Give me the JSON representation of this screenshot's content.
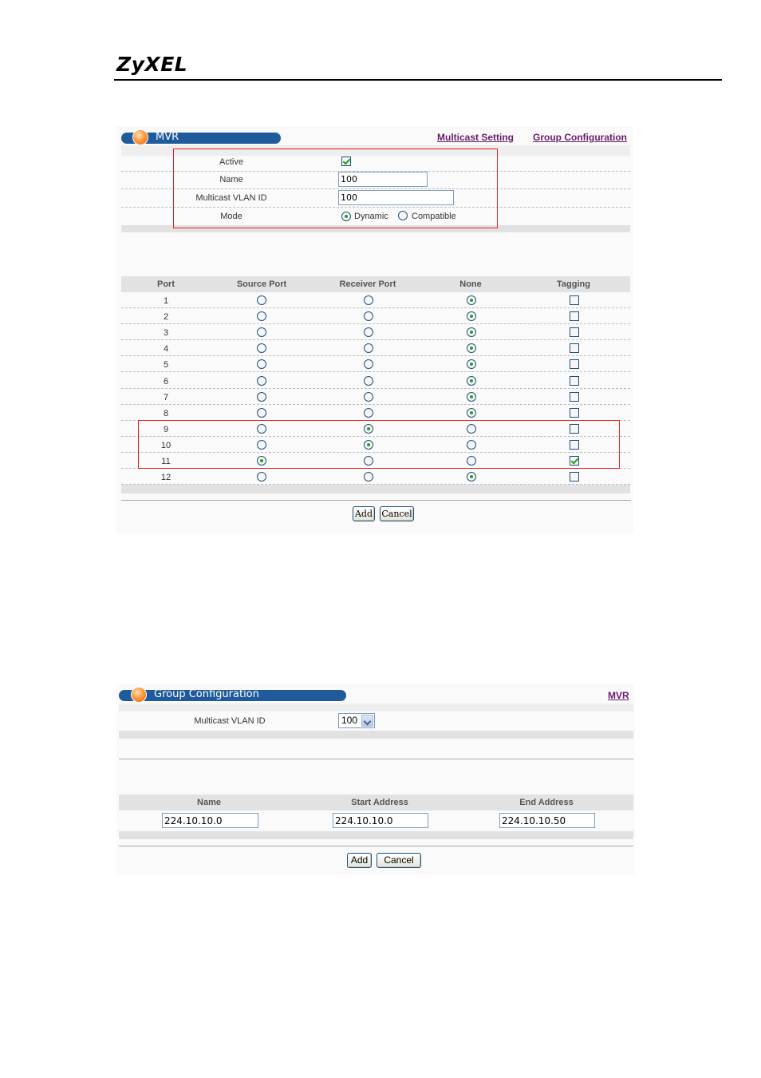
{
  "brand": {
    "logo": "ZyXEL"
  },
  "mvr": {
    "title": "MVR",
    "links": {
      "multicast_setting": "Multicast Setting",
      "group_configuration": "Group Configuration"
    },
    "fields": {
      "active_label": "Active",
      "active_checked": true,
      "name_label": "Name",
      "name_value": "100",
      "vlan_label": "Multicast VLAN ID",
      "vlan_value": "100",
      "mode_label": "Mode",
      "mode_options": [
        "Dynamic",
        "Compatible"
      ],
      "mode_selected": "Dynamic"
    },
    "ports_table": {
      "headers": [
        "Port",
        "Source Port",
        "Receiver Port",
        "None",
        "Tagging"
      ],
      "rows": [
        {
          "port": "1",
          "role": "none",
          "tagging": false
        },
        {
          "port": "2",
          "role": "none",
          "tagging": false
        },
        {
          "port": "3",
          "role": "none",
          "tagging": false
        },
        {
          "port": "4",
          "role": "none",
          "tagging": false
        },
        {
          "port": "5",
          "role": "none",
          "tagging": false
        },
        {
          "port": "6",
          "role": "none",
          "tagging": false
        },
        {
          "port": "7",
          "role": "none",
          "tagging": false
        },
        {
          "port": "8",
          "role": "none",
          "tagging": false
        },
        {
          "port": "9",
          "role": "receiver",
          "tagging": false
        },
        {
          "port": "10",
          "role": "receiver",
          "tagging": false
        },
        {
          "port": "11",
          "role": "source",
          "tagging": true
        },
        {
          "port": "12",
          "role": "none",
          "tagging": false
        }
      ]
    },
    "buttons": {
      "add": "Add",
      "cancel": "Cancel"
    }
  },
  "group_config": {
    "title": "Group Configuration",
    "links": {
      "mvr": "MVR"
    },
    "vlan_label": "Multicast VLAN ID",
    "vlan_selected": "100",
    "table": {
      "headers": [
        "Name",
        "Start Address",
        "End Address"
      ],
      "values": [
        "224.10.10.0",
        "224.10.10.0",
        "224.10.10.50"
      ]
    },
    "buttons": {
      "add": "Add",
      "cancel": "Cancel"
    }
  },
  "colors": {
    "title_bar": "#1f5b9c",
    "link": "#6b1b6b",
    "highlight": "#e02020",
    "check_green": "#21a121"
  }
}
